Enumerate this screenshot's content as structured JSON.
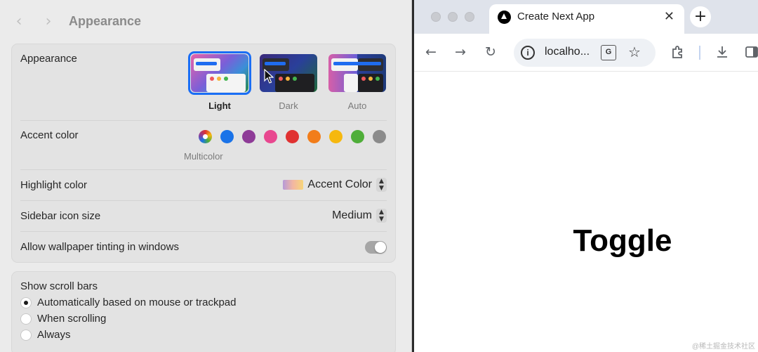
{
  "settings": {
    "title": "Appearance",
    "appearance": {
      "label": "Appearance",
      "options": [
        {
          "label": "Light",
          "selected": true
        },
        {
          "label": "Dark",
          "selected": false
        },
        {
          "label": "Auto",
          "selected": false
        }
      ]
    },
    "accent": {
      "label": "Accent color",
      "selected_label": "Multicolor",
      "swatches": [
        {
          "name": "multicolor",
          "color": "conic"
        },
        {
          "name": "blue",
          "color": "#1a73e8"
        },
        {
          "name": "purple",
          "color": "#8e3b97"
        },
        {
          "name": "pink",
          "color": "#e8478f"
        },
        {
          "name": "red",
          "color": "#e03131"
        },
        {
          "name": "orange",
          "color": "#f27d1a"
        },
        {
          "name": "yellow",
          "color": "#f6b80e"
        },
        {
          "name": "green",
          "color": "#4fae39"
        },
        {
          "name": "graphite",
          "color": "#8b8b8b"
        }
      ]
    },
    "highlight": {
      "label": "Highlight color",
      "value": "Accent Color"
    },
    "sidebar_icon": {
      "label": "Sidebar icon size",
      "value": "Medium"
    },
    "tinting": {
      "label": "Allow wallpaper tinting in windows",
      "on": true
    },
    "scrollbars": {
      "label": "Show scroll bars",
      "options": [
        {
          "label": "Automatically based on mouse or trackpad",
          "selected": true
        },
        {
          "label": "When scrolling",
          "selected": false
        },
        {
          "label": "Always",
          "selected": false
        }
      ]
    }
  },
  "browser": {
    "tab_title": "Create Next App",
    "url": "localho...",
    "translate_icon_text": "G",
    "page_heading": "Toggle",
    "colors": {
      "tabstrip": "#dfe3eb",
      "omnibox": "#eef1f5"
    }
  },
  "watermark": "@稀土掘金技术社区"
}
